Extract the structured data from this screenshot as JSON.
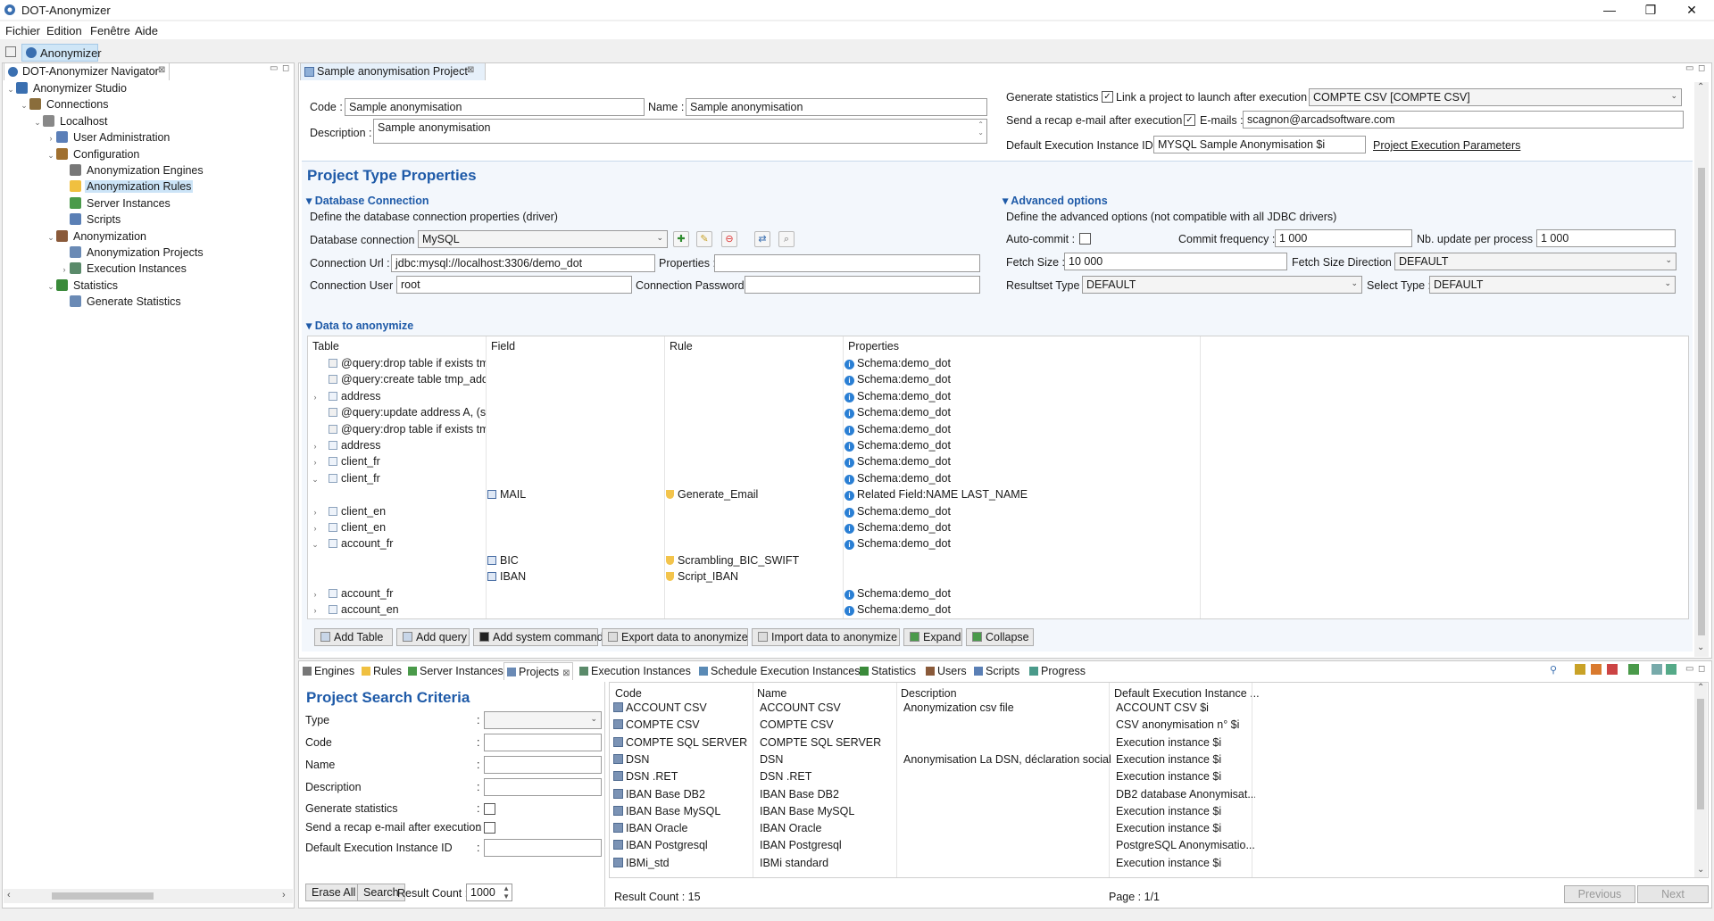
{
  "window": {
    "title": "DOT-Anonymizer",
    "min": "—",
    "max": "❐",
    "close": "✕"
  },
  "menu": [
    "Fichier",
    "Edition",
    "Fenêtre",
    "Aide"
  ],
  "perspective": {
    "label": "Anonymizer"
  },
  "navigator": {
    "tab": "DOT-Anonymizer Navigator",
    "items": [
      {
        "label": "Anonymizer Studio",
        "depth": 0,
        "tw": "⌄",
        "icon": "#3a6fb0"
      },
      {
        "label": "Connections",
        "depth": 1,
        "tw": "⌄",
        "icon": "#8a6d3b"
      },
      {
        "label": "Localhost",
        "depth": 2,
        "tw": "⌄",
        "icon": "#888"
      },
      {
        "label": "User Administration",
        "depth": 3,
        "tw": "›",
        "icon": "#5b7fb8"
      },
      {
        "label": "Configuration",
        "depth": 3,
        "tw": "⌄",
        "icon": "#a07030"
      },
      {
        "label": "Anonymization Engines",
        "depth": 4,
        "tw": "",
        "icon": "#777"
      },
      {
        "label": "Anonymization Rules",
        "depth": 4,
        "tw": "",
        "icon": "#f0c040",
        "selected": true
      },
      {
        "label": "Server Instances",
        "depth": 4,
        "tw": "",
        "icon": "#4a9a4a"
      },
      {
        "label": "Scripts",
        "depth": 4,
        "tw": "",
        "icon": "#5a7fb5"
      },
      {
        "label": "Anonymization",
        "depth": 3,
        "tw": "⌄",
        "icon": "#8a5a3a"
      },
      {
        "label": "Anonymization Projects",
        "depth": 4,
        "tw": "",
        "icon": "#6a8ab5"
      },
      {
        "label": "Execution Instances",
        "depth": 4,
        "tw": "›",
        "icon": "#5a8a6a"
      },
      {
        "label": "Statistics",
        "depth": 3,
        "tw": "⌄",
        "icon": "#3a8a3a"
      },
      {
        "label": "Generate Statistics",
        "depth": 4,
        "tw": "",
        "icon": "#6a8ab5"
      }
    ]
  },
  "editor": {
    "tab": "Sample anonymisation Project",
    "code_label": "Code :",
    "code": "Sample anonymisation",
    "name_label": "Name :",
    "name": "Sample anonymisation",
    "desc_label": "Description :",
    "desc": "Sample anonymisation",
    "gen_stats_label": "Generate statistics :",
    "link_label": "Link a project to launch after execution :",
    "link_value": "COMPTE CSV [COMPTE CSV]",
    "recap_label": "Send a recap e-mail after execution :",
    "emails_label": "E-mails :",
    "emails": "scagnon@arcadsoftware.com",
    "default_exec_label": "Default Execution Instance ID :",
    "default_exec": "MYSQL Sample Anonymisation $i",
    "params_link": "Project Execution Parameters",
    "ptp_title": "Project Type Properties",
    "db_title": "Database Connection",
    "db_desc": "Define the database connection properties (driver)",
    "db_conn_label": "Database connection :",
    "db_conn": "MySQL",
    "url_label": "Connection Url :",
    "url": "jdbc:mysql://localhost:3306/demo_dot",
    "props_label": "Properties :",
    "props": "",
    "user_label": "Connection User :",
    "user": "root",
    "pwd_label": "Connection Password :",
    "pwd": "",
    "adv_title": "Advanced options",
    "adv_desc": "Define the advanced options (not compatible with all JDBC drivers)",
    "autocommit_label": "Auto-commit :",
    "commit_freq_label": "Commit frequency :",
    "commit_freq": "1 000",
    "nb_update_label": "Nb. update per process :",
    "nb_update": "1 000",
    "fetch_size_label": "Fetch Size :",
    "fetch_size": "10 000",
    "fetch_dir_label": "Fetch Size Direction :",
    "fetch_dir": "DEFAULT",
    "rs_type_label": "Resultset Type :",
    "rs_type": "DEFAULT",
    "sel_type_label": "Select Type :",
    "sel_type": "DEFAULT",
    "dta_title": "Data to anonymize",
    "cols": [
      "Table",
      "Field",
      "Rule",
      "Properties"
    ],
    "rows": [
      {
        "tw": "",
        "t": "@query:drop table if exists tmp",
        "f": "",
        "r": "",
        "p": "Schema:demo_dot",
        "kind": "q"
      },
      {
        "tw": "",
        "t": "@query:create table tmp_addre",
        "f": "",
        "r": "",
        "p": "Schema:demo_dot",
        "kind": "q"
      },
      {
        "tw": "›",
        "t": "address",
        "f": "",
        "r": "",
        "p": "Schema:demo_dot",
        "kind": "t"
      },
      {
        "tw": "",
        "t": "@query:update  address A, (sel",
        "f": "",
        "r": "",
        "p": "Schema:demo_dot",
        "kind": "q"
      },
      {
        "tw": "",
        "t": "@query:drop table if exists tmp",
        "f": "",
        "r": "",
        "p": "Schema:demo_dot",
        "kind": "q"
      },
      {
        "tw": "›",
        "t": "address",
        "f": "",
        "r": "",
        "p": "Schema:demo_dot",
        "kind": "t"
      },
      {
        "tw": "›",
        "t": "client_fr",
        "f": "",
        "r": "",
        "p": "Schema:demo_dot",
        "kind": "t"
      },
      {
        "tw": "⌄",
        "t": "client_fr",
        "f": "",
        "r": "",
        "p": "Schema:demo_dot",
        "kind": "t"
      },
      {
        "tw": "",
        "t": "",
        "f": "MAIL",
        "r": "Generate_Email",
        "p": "Related Field:NAME LAST_NAME",
        "kind": "f"
      },
      {
        "tw": "›",
        "t": "client_en",
        "f": "",
        "r": "",
        "p": "Schema:demo_dot",
        "kind": "t"
      },
      {
        "tw": "›",
        "t": "client_en",
        "f": "",
        "r": "",
        "p": "Schema:demo_dot",
        "kind": "t"
      },
      {
        "tw": "⌄",
        "t": "account_fr",
        "f": "",
        "r": "",
        "p": "Schema:demo_dot",
        "kind": "t"
      },
      {
        "tw": "",
        "t": "",
        "f": "BIC",
        "r": "Scrambling_BIC_SWIFT",
        "p": "",
        "kind": "f"
      },
      {
        "tw": "",
        "t": "",
        "f": "IBAN",
        "r": "Script_IBAN",
        "p": "",
        "kind": "f"
      },
      {
        "tw": "›",
        "t": "account_fr",
        "f": "",
        "r": "",
        "p": "Schema:demo_dot",
        "kind": "t"
      },
      {
        "tw": "›",
        "t": "account_en",
        "f": "",
        "r": "",
        "p": "Schema:demo_dot",
        "kind": "t"
      }
    ],
    "buttons": [
      "Add Table",
      "Add query",
      "Add system command",
      "Export data to anonymize",
      "Import data to anonymize",
      "Expand",
      "Collapse"
    ]
  },
  "bottom": {
    "tabs": [
      "Engines",
      "Rules",
      "Server Instances",
      "Projects",
      "Execution Instances",
      "Schedule Execution Instances",
      "Statistics",
      "Users",
      "Scripts",
      "Progress"
    ],
    "search": {
      "title": "Project Search Criteria",
      "fields": [
        "Type",
        "Code",
        "Name",
        "Description",
        "Generate statistics",
        "Send a recap e-mail after execution",
        "Default Execution Instance ID"
      ],
      "colon": ":",
      "erase": "Erase All",
      "search": "Search",
      "result_count_label": "Result Count :",
      "result_count": "1000"
    },
    "results": {
      "cols": [
        "Code",
        "Name",
        "Description",
        "Default Execution Instance ..."
      ],
      "rows": [
        [
          "ACCOUNT CSV",
          "ACCOUNT CSV",
          "Anonymization csv file",
          "ACCOUNT CSV $i"
        ],
        [
          "COMPTE CSV",
          "COMPTE CSV",
          "",
          "CSV anonymisation n° $i"
        ],
        [
          "COMPTE SQL SERVER",
          "COMPTE SQL SERVER",
          "",
          "Execution instance $i"
        ],
        [
          "DSN",
          "DSN",
          "Anonymisation La DSN, déclaration social...",
          "Execution instance $i"
        ],
        [
          "DSN .RET",
          "DSN .RET",
          "",
          "Execution instance $i"
        ],
        [
          "IBAN Base DB2",
          "IBAN Base DB2",
          "",
          "DB2 database Anonymisat..."
        ],
        [
          "IBAN Base MySQL",
          "IBAN Base MySQL",
          "",
          "Execution instance $i"
        ],
        [
          "IBAN Oracle",
          "IBAN Oracle",
          "",
          "Execution instance $i"
        ],
        [
          "IBAN Postgresql",
          "IBAN Postgresql",
          "",
          "PostgreSQL Anonymisatio..."
        ],
        [
          "IBMi_std",
          "IBMi standard",
          "",
          "Execution instance $i"
        ]
      ],
      "result_count": "Result Count : 15",
      "page": "Page : 1/1",
      "previous": "Previous",
      "next": "Next"
    }
  }
}
